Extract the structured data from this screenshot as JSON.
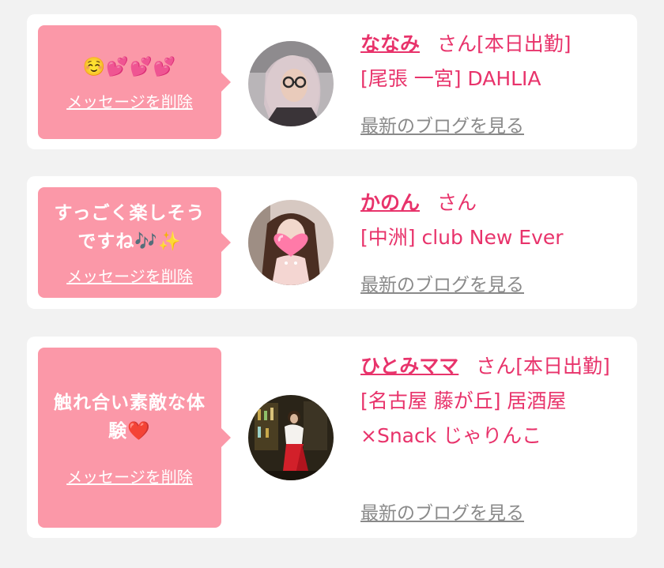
{
  "messages": [
    {
      "bubble_text": "☺️💕💕💕",
      "delete_label": "メッセージを削除",
      "name": "ななみ",
      "honorific": "さん[本日出勤]",
      "shop_lines": [
        "[尾張 一宮] DAHLIA"
      ],
      "blog_label": "最新のブログを見る",
      "avatar_icon": "girl-with-glasses-avatar"
    },
    {
      "bubble_text": "すっごく楽しそう\nですね🎶✨",
      "delete_label": "メッセージを削除",
      "name": "かのん",
      "honorific": "さん",
      "shop_lines": [
        "[中洲] club New Ever"
      ],
      "blog_label": "最新のブログを見る",
      "avatar_icon": "girl-with-heart-sticker-avatar"
    },
    {
      "bubble_text": "触れ合い素敵な体\n験❤️",
      "delete_label": "メッセージを削除",
      "name": "ひとみママ",
      "honorific": "さん[本日出勤]",
      "shop_lines": [
        "[名古屋 藤が丘] 居酒屋",
        "×Snack じゃりんこ"
      ],
      "blog_label": "最新のブログを見る",
      "avatar_icon": "woman-in-bar-avatar"
    }
  ],
  "colors": {
    "accent": "#e8336b",
    "bubble": "#fb98a8",
    "link_gray": "#8a8a8a",
    "background": "#f2f2f2"
  }
}
